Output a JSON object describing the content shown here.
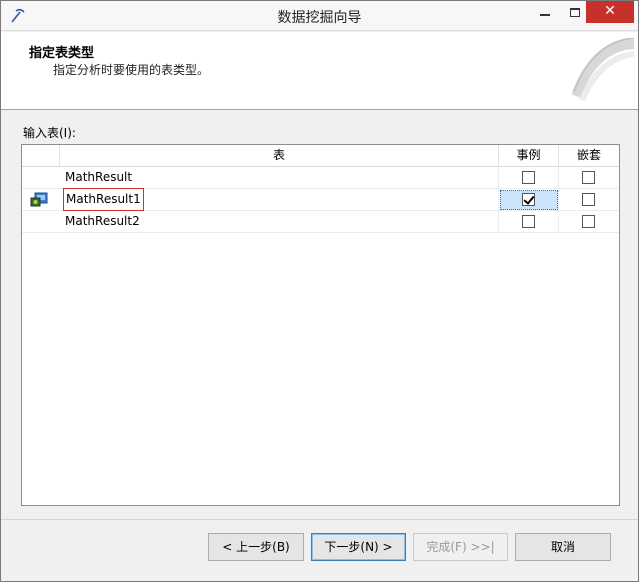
{
  "window": {
    "title": "数据挖掘向导",
    "close_label": "✕"
  },
  "header": {
    "title": "指定表类型",
    "subtitle": "指定分析时要使用的表类型。"
  },
  "input_label": "输入表(I):",
  "grid": {
    "columns": {
      "table": "表",
      "case": "事例",
      "nested": "嵌套"
    },
    "rows": [
      {
        "name": "MathResult",
        "case": false,
        "nested": false
      },
      {
        "name": "MathResult1",
        "case": true,
        "nested": false
      },
      {
        "name": "MathResult2",
        "case": false,
        "nested": false
      }
    ]
  },
  "buttons": {
    "back": "< 上一步(B)",
    "next": "下一步(N) >",
    "finish": "完成(F) >>|",
    "cancel": "取消"
  },
  "colors": {
    "close_button": "#c7312c",
    "selection": "#cce4fb",
    "highlight_border": "#d0302a"
  }
}
